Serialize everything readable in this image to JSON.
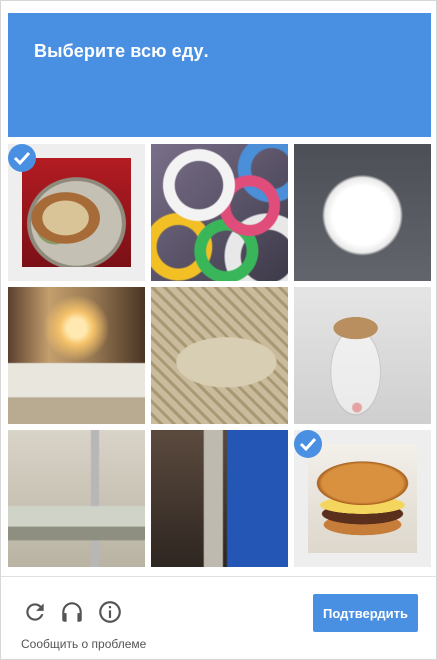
{
  "header": {
    "title_prefix": "Выберите всю ",
    "title_keyword": "еду",
    "title_suffix": ".",
    "background_color": "#4a90e2"
  },
  "grid": {
    "tiles": [
      {
        "label": "sandwich",
        "selected": true
      },
      {
        "label": "tape-rolls",
        "selected": false
      },
      {
        "label": "salt",
        "selected": false
      },
      {
        "label": "ballroom",
        "selected": false
      },
      {
        "label": "sofa",
        "selected": false
      },
      {
        "label": "bottle",
        "selected": false
      },
      {
        "label": "sink",
        "selected": false
      },
      {
        "label": "pipes",
        "selected": false
      },
      {
        "label": "burger",
        "selected": true
      }
    ]
  },
  "footer": {
    "icons": [
      "reload-icon",
      "audio-icon",
      "info-icon"
    ],
    "verify_label": "Подтвердить",
    "report_label": "Сообщить о проблеме"
  },
  "colors": {
    "accent": "#4a90e2",
    "icon_gray": "#555555"
  }
}
